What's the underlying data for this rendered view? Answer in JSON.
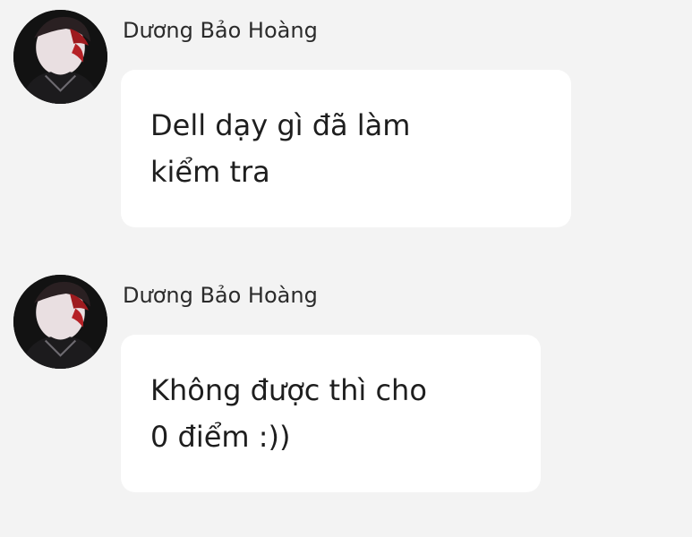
{
  "messages": [
    {
      "sender": "Dương Bảo Hoàng",
      "avatar_icon": "user-avatar-photo",
      "lines": [
        "Dell dạy gì đã làm",
        "kiểm tra"
      ]
    },
    {
      "sender": "Dương Bảo Hoàng",
      "avatar_icon": "user-avatar-photo",
      "lines": [
        "Không được thì cho",
        "0 điểm :))"
      ]
    }
  ],
  "colors": {
    "background": "#f3f3f3",
    "bubble": "#ffffff",
    "text": "#1e1e1e"
  }
}
